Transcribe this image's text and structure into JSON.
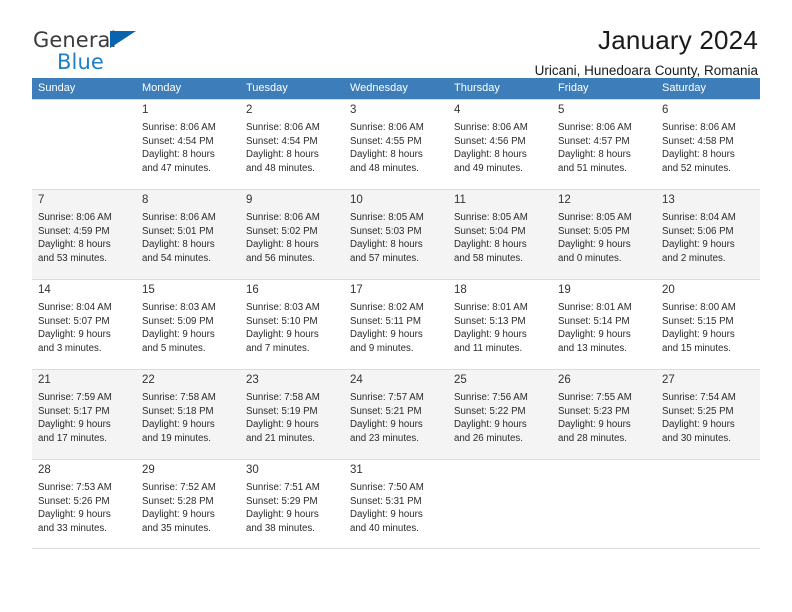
{
  "brand": {
    "name_part1": "General",
    "name_part2": "Blue",
    "accent_color": "#1f7fc4",
    "triangle_color": "#0a63ad"
  },
  "header": {
    "title": "January 2024",
    "subtitle": "Uricani, Hunedoara County, Romania"
  },
  "calendar": {
    "header_background": "#3d7dba",
    "weekday_headers": [
      "Sunday",
      "Monday",
      "Tuesday",
      "Wednesday",
      "Thursday",
      "Friday",
      "Saturday"
    ],
    "weeks": [
      [
        {
          "day": "",
          "info": ""
        },
        {
          "day": "1",
          "info": "Sunrise: 8:06 AM\nSunset: 4:54 PM\nDaylight: 8 hours\nand 47 minutes."
        },
        {
          "day": "2",
          "info": "Sunrise: 8:06 AM\nSunset: 4:54 PM\nDaylight: 8 hours\nand 48 minutes."
        },
        {
          "day": "3",
          "info": "Sunrise: 8:06 AM\nSunset: 4:55 PM\nDaylight: 8 hours\nand 48 minutes."
        },
        {
          "day": "4",
          "info": "Sunrise: 8:06 AM\nSunset: 4:56 PM\nDaylight: 8 hours\nand 49 minutes."
        },
        {
          "day": "5",
          "info": "Sunrise: 8:06 AM\nSunset: 4:57 PM\nDaylight: 8 hours\nand 51 minutes."
        },
        {
          "day": "6",
          "info": "Sunrise: 8:06 AM\nSunset: 4:58 PM\nDaylight: 8 hours\nand 52 minutes."
        }
      ],
      [
        {
          "day": "7",
          "info": "Sunrise: 8:06 AM\nSunset: 4:59 PM\nDaylight: 8 hours\nand 53 minutes."
        },
        {
          "day": "8",
          "info": "Sunrise: 8:06 AM\nSunset: 5:01 PM\nDaylight: 8 hours\nand 54 minutes."
        },
        {
          "day": "9",
          "info": "Sunrise: 8:06 AM\nSunset: 5:02 PM\nDaylight: 8 hours\nand 56 minutes."
        },
        {
          "day": "10",
          "info": "Sunrise: 8:05 AM\nSunset: 5:03 PM\nDaylight: 8 hours\nand 57 minutes."
        },
        {
          "day": "11",
          "info": "Sunrise: 8:05 AM\nSunset: 5:04 PM\nDaylight: 8 hours\nand 58 minutes."
        },
        {
          "day": "12",
          "info": "Sunrise: 8:05 AM\nSunset: 5:05 PM\nDaylight: 9 hours\nand 0 minutes."
        },
        {
          "day": "13",
          "info": "Sunrise: 8:04 AM\nSunset: 5:06 PM\nDaylight: 9 hours\nand 2 minutes."
        }
      ],
      [
        {
          "day": "14",
          "info": "Sunrise: 8:04 AM\nSunset: 5:07 PM\nDaylight: 9 hours\nand 3 minutes."
        },
        {
          "day": "15",
          "info": "Sunrise: 8:03 AM\nSunset: 5:09 PM\nDaylight: 9 hours\nand 5 minutes."
        },
        {
          "day": "16",
          "info": "Sunrise: 8:03 AM\nSunset: 5:10 PM\nDaylight: 9 hours\nand 7 minutes."
        },
        {
          "day": "17",
          "info": "Sunrise: 8:02 AM\nSunset: 5:11 PM\nDaylight: 9 hours\nand 9 minutes."
        },
        {
          "day": "18",
          "info": "Sunrise: 8:01 AM\nSunset: 5:13 PM\nDaylight: 9 hours\nand 11 minutes."
        },
        {
          "day": "19",
          "info": "Sunrise: 8:01 AM\nSunset: 5:14 PM\nDaylight: 9 hours\nand 13 minutes."
        },
        {
          "day": "20",
          "info": "Sunrise: 8:00 AM\nSunset: 5:15 PM\nDaylight: 9 hours\nand 15 minutes."
        }
      ],
      [
        {
          "day": "21",
          "info": "Sunrise: 7:59 AM\nSunset: 5:17 PM\nDaylight: 9 hours\nand 17 minutes."
        },
        {
          "day": "22",
          "info": "Sunrise: 7:58 AM\nSunset: 5:18 PM\nDaylight: 9 hours\nand 19 minutes."
        },
        {
          "day": "23",
          "info": "Sunrise: 7:58 AM\nSunset: 5:19 PM\nDaylight: 9 hours\nand 21 minutes."
        },
        {
          "day": "24",
          "info": "Sunrise: 7:57 AM\nSunset: 5:21 PM\nDaylight: 9 hours\nand 23 minutes."
        },
        {
          "day": "25",
          "info": "Sunrise: 7:56 AM\nSunset: 5:22 PM\nDaylight: 9 hours\nand 26 minutes."
        },
        {
          "day": "26",
          "info": "Sunrise: 7:55 AM\nSunset: 5:23 PM\nDaylight: 9 hours\nand 28 minutes."
        },
        {
          "day": "27",
          "info": "Sunrise: 7:54 AM\nSunset: 5:25 PM\nDaylight: 9 hours\nand 30 minutes."
        }
      ],
      [
        {
          "day": "28",
          "info": "Sunrise: 7:53 AM\nSunset: 5:26 PM\nDaylight: 9 hours\nand 33 minutes."
        },
        {
          "day": "29",
          "info": "Sunrise: 7:52 AM\nSunset: 5:28 PM\nDaylight: 9 hours\nand 35 minutes."
        },
        {
          "day": "30",
          "info": "Sunrise: 7:51 AM\nSunset: 5:29 PM\nDaylight: 9 hours\nand 38 minutes."
        },
        {
          "day": "31",
          "info": "Sunrise: 7:50 AM\nSunset: 5:31 PM\nDaylight: 9 hours\nand 40 minutes."
        },
        {
          "day": "",
          "info": ""
        },
        {
          "day": "",
          "info": ""
        },
        {
          "day": "",
          "info": ""
        }
      ]
    ]
  }
}
